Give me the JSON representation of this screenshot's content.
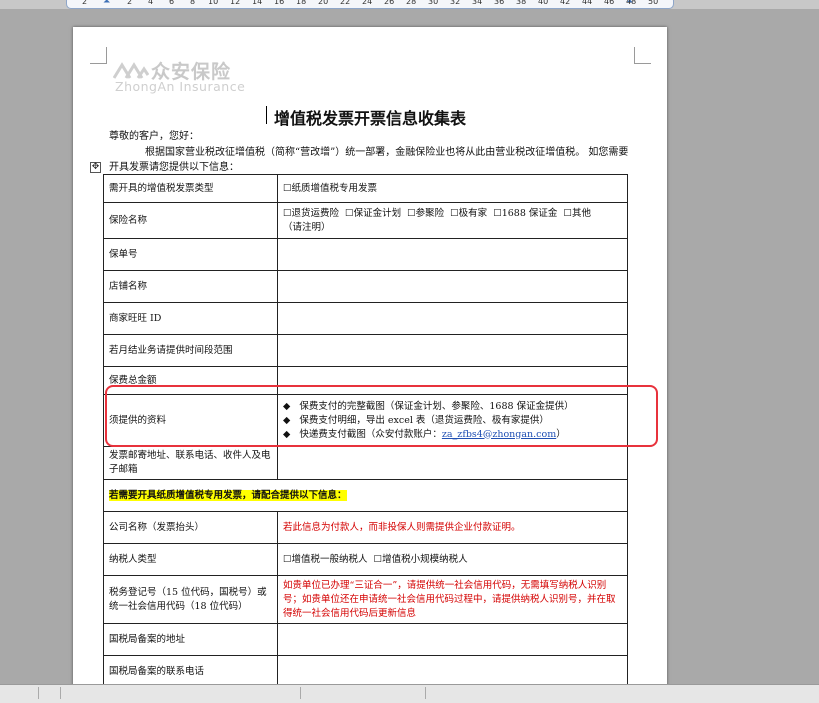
{
  "ruler": {
    "numbers": [
      "2",
      "2",
      "4",
      "6",
      "8",
      "10",
      "12",
      "14",
      "16",
      "18",
      "20",
      "22",
      "24",
      "26",
      "28",
      "30",
      "32",
      "34",
      "36",
      "38",
      "40",
      "42",
      "44",
      "46",
      "48",
      "50"
    ]
  },
  "logo": {
    "cn": "众安保险",
    "en": "ZhongAn Insurance"
  },
  "title": "增值税发票开票信息收集表",
  "greeting": "尊敬的客户，您好：",
  "intro": "根据国家营业税改征增值税（简称“营改增”）统一部署，金融保险业也将从此由营业税改征增值税。 如您需要开具发票请您提供以下信息：",
  "table": {
    "invoice_type": {
      "label": "需开具的增值税发票类型",
      "option": "纸质增值税专用发票"
    },
    "insurance_name": {
      "label": "保险名称",
      "options": [
        "退货运费险",
        "保证金计划",
        "参聚险",
        "极有家",
        "1688 保证金",
        "其他"
      ],
      "note": "（请注明）"
    },
    "policy_no": {
      "label": "保单号"
    },
    "shop_name": {
      "label": "店铺名称"
    },
    "merchant_id": {
      "label": "商家旺旺 ID"
    },
    "monthly_period": {
      "label": "若月结业务请提供时间段范围"
    },
    "premium_total": {
      "label": "保费总金额"
    },
    "required_docs": {
      "label": "须提供的资料",
      "bullet_symbol": "◆",
      "items": [
        "保费支付的完整截图（保证金计划、参聚险、1688 保证金提供）",
        "保费支付明细，导出 excel 表（退货运费险、极有家提供）",
        "快递费支付截图（众安付款账户："
      ],
      "account": "za_zfbs4@zhongan.com",
      "account_suffix": "）"
    },
    "mail_info": {
      "label": "发票邮寄地址、联系电话、收件人及电子邮箱"
    },
    "paper_notice": "若需要开具纸质增值税专用发票，请配合提供以下信息：",
    "company_name": {
      "label": "公司名称（发票抬头）",
      "note": "若此信息为付款人，而非投保人则需提供企业付款证明。"
    },
    "taxpayer_type": {
      "label": "纳税人类型",
      "options": [
        "增值税一般纳税人",
        "增值税小规模纳税人"
      ]
    },
    "tax_reg": {
      "label": "税务登记号（15 位代码，国税号）或统一社会信用代码（18 位代码）",
      "note": "如贵单位已办理“三证合一”，请提供统一社会信用代码，无需填写纳税人识别号；如贵单位还在申请统一社会信用代码过程中，请提供纳税人识别号，并在取得统一社会信用代码后更新信息"
    },
    "registered_address": {
      "label": "国税局备案的地址"
    },
    "registered_phone": {
      "label": "国税局备案的联系电话"
    }
  },
  "checkbox_glyph": "☐",
  "colors": {
    "annotation": "#e8323c",
    "highlight": "#ffff00",
    "note_red": "#d40000",
    "link": "#1f4fb3"
  }
}
